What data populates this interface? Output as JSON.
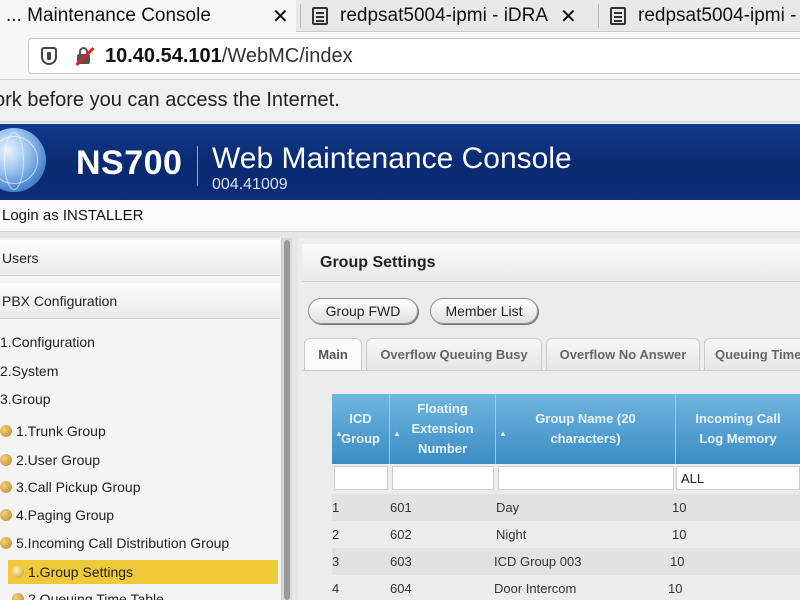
{
  "browser": {
    "tabs": [
      {
        "title": "... Maintenance Console",
        "active": true
      },
      {
        "title": "redpsat5004-ipmi - iDRA",
        "active": false
      },
      {
        "title": "redpsat5004-ipmi - ",
        "active": false
      }
    ],
    "close_glyph": "✕",
    "url_host": "10.40.54.101",
    "url_path": "/WebMC/index",
    "notice": "ork before you can access the Internet."
  },
  "header": {
    "model": "NS700",
    "title": "Web Maintenance Console",
    "version": "004.41009"
  },
  "login": "Login as INSTALLER",
  "sidebar": {
    "items": [
      {
        "label": "Users",
        "level": "section"
      },
      {
        "label": "PBX Configuration",
        "level": "section"
      },
      {
        "label": "1.Configuration",
        "level": "cat"
      },
      {
        "label": "2.System",
        "level": "cat"
      },
      {
        "label": "3.Group",
        "level": "cat"
      },
      {
        "label": "1.Trunk Group",
        "level": "sub"
      },
      {
        "label": "2.User Group",
        "level": "sub"
      },
      {
        "label": "3.Call Pickup Group",
        "level": "sub"
      },
      {
        "label": "4.Paging Group",
        "level": "sub"
      },
      {
        "label": "5.Incoming Call Distribution Group",
        "level": "sub"
      },
      {
        "label": "1.Group Settings",
        "level": "subsub",
        "selected": true
      },
      {
        "label": "2.Queuing Time Table",
        "level": "subsub"
      }
    ]
  },
  "main": {
    "title": "Group Settings",
    "buttons": {
      "group_fwd": "Group FWD",
      "member_list": "Member List"
    },
    "tabs": [
      "Main",
      "Overflow Queuing Busy",
      "Overflow No Answer",
      "Queuing Time"
    ],
    "table": {
      "headers": [
        "ICD Group",
        "Floating Extension Number",
        "Group Name (20 characters)",
        "Incoming Call Log Memory"
      ],
      "filter_value": "ALL",
      "rows": [
        {
          "group": "1",
          "ext": "601",
          "name": "Day",
          "log": "10"
        },
        {
          "group": "2",
          "ext": "602",
          "name": "Night",
          "log": "10"
        },
        {
          "group": "3",
          "ext": "603",
          "name": "ICD Group 003",
          "log": "10"
        },
        {
          "group": "4",
          "ext": "604",
          "name": "Door Intercom",
          "log": "10"
        }
      ]
    }
  },
  "colors": {
    "header_blue": "#0a2a70",
    "grid_header": "#3b8cc4",
    "selected_item": "#f0c93a"
  }
}
